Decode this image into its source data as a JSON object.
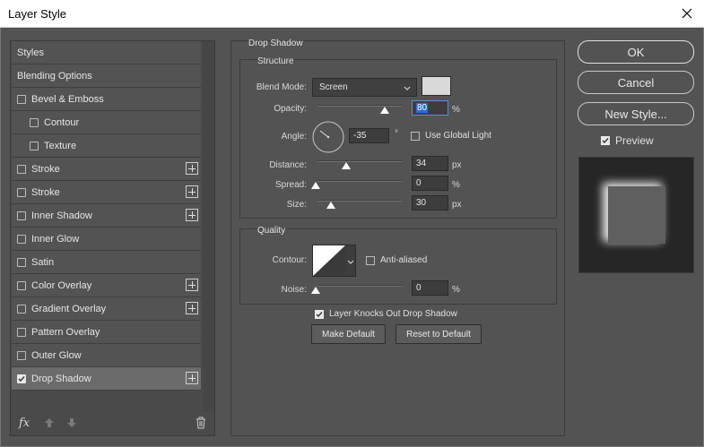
{
  "window": {
    "title": "Layer Style"
  },
  "styles_list": [
    {
      "label": "Styles",
      "type": "header",
      "checkbox": false,
      "checked": false,
      "plus": false,
      "indent": 0,
      "selected": false
    },
    {
      "label": "Blending Options",
      "type": "header",
      "checkbox": false,
      "checked": false,
      "plus": false,
      "indent": 0,
      "selected": false
    },
    {
      "label": "Bevel & Emboss",
      "type": "item",
      "checkbox": true,
      "checked": false,
      "plus": false,
      "indent": 0,
      "selected": false
    },
    {
      "label": "Contour",
      "type": "item",
      "checkbox": true,
      "checked": false,
      "plus": false,
      "indent": 1,
      "selected": false
    },
    {
      "label": "Texture",
      "type": "item",
      "checkbox": true,
      "checked": false,
      "plus": false,
      "indent": 1,
      "selected": false
    },
    {
      "label": "Stroke",
      "type": "item",
      "checkbox": true,
      "checked": false,
      "plus": true,
      "indent": 0,
      "selected": false
    },
    {
      "label": "Stroke",
      "type": "item",
      "checkbox": true,
      "checked": false,
      "plus": true,
      "indent": 0,
      "selected": false
    },
    {
      "label": "Inner Shadow",
      "type": "item",
      "checkbox": true,
      "checked": false,
      "plus": true,
      "indent": 0,
      "selected": false
    },
    {
      "label": "Inner Glow",
      "type": "item",
      "checkbox": true,
      "checked": false,
      "plus": false,
      "indent": 0,
      "selected": false
    },
    {
      "label": "Satin",
      "type": "item",
      "checkbox": true,
      "checked": false,
      "plus": false,
      "indent": 0,
      "selected": false
    },
    {
      "label": "Color Overlay",
      "type": "item",
      "checkbox": true,
      "checked": false,
      "plus": true,
      "indent": 0,
      "selected": false
    },
    {
      "label": "Gradient Overlay",
      "type": "item",
      "checkbox": true,
      "checked": false,
      "plus": true,
      "indent": 0,
      "selected": false
    },
    {
      "label": "Pattern Overlay",
      "type": "item",
      "checkbox": true,
      "checked": false,
      "plus": false,
      "indent": 0,
      "selected": false
    },
    {
      "label": "Outer Glow",
      "type": "item",
      "checkbox": true,
      "checked": false,
      "plus": false,
      "indent": 0,
      "selected": false
    },
    {
      "label": "Drop Shadow",
      "type": "item",
      "checkbox": true,
      "checked": true,
      "plus": true,
      "indent": 0,
      "selected": true
    }
  ],
  "footer": {
    "fx_label": "fx"
  },
  "drop_shadow": {
    "section_title": "Drop Shadow",
    "structure": {
      "title": "Structure",
      "blend_mode_label": "Blend Mode:",
      "blend_mode_value": "Screen",
      "shadow_color": "#d9d9d9",
      "opacity_label": "Opacity:",
      "opacity_value": "80",
      "opacity_unit": "%",
      "opacity_fraction": 0.8,
      "angle_label": "Angle:",
      "angle_value": "-35",
      "angle_unit": "°",
      "use_global_light_label": "Use Global Light",
      "use_global_light_checked": false,
      "distance_label": "Distance:",
      "distance_value": "34",
      "distance_unit": "px",
      "spread_label": "Spread:",
      "spread_value": "0",
      "spread_unit": "%",
      "size_label": "Size:",
      "size_value": "30",
      "size_unit": "px"
    },
    "quality": {
      "title": "Quality",
      "contour_label": "Contour:",
      "anti_aliased_label": "Anti-aliased",
      "anti_aliased_checked": false,
      "noise_label": "Noise:",
      "noise_value": "0",
      "noise_unit": "%"
    },
    "layer_knocks_out_label": "Layer Knocks Out Drop Shadow",
    "layer_knocks_out_checked": true,
    "make_default_label": "Make Default",
    "reset_default_label": "Reset to Default"
  },
  "actions": {
    "ok_label": "OK",
    "cancel_label": "Cancel",
    "new_style_label": "New Style...",
    "preview_label": "Preview",
    "preview_checked": true
  }
}
